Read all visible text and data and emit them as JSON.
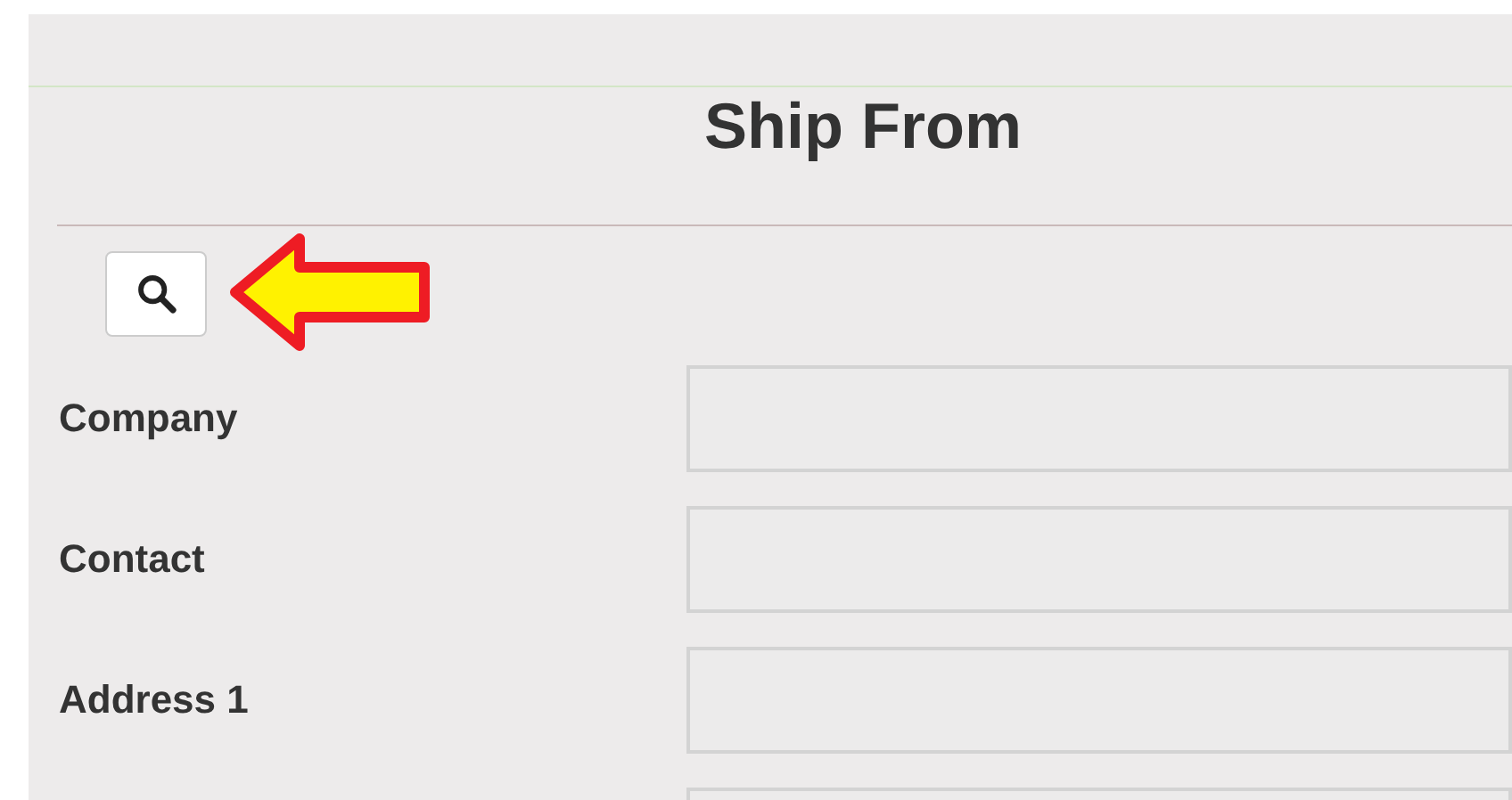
{
  "title": "Ship From",
  "fields": [
    {
      "kind": "labeled",
      "label": "Company"
    },
    {
      "kind": "labeled",
      "label": "Contact"
    },
    {
      "kind": "labeled",
      "label": "Address 1"
    },
    {
      "kind": "unlabeled"
    }
  ]
}
